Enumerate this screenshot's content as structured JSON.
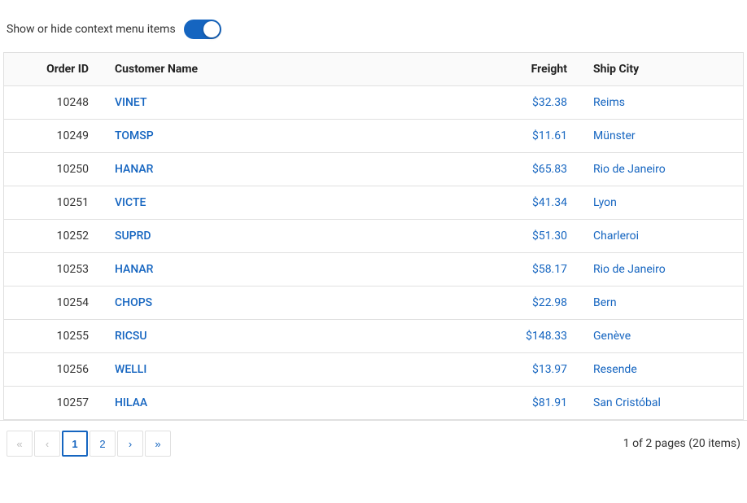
{
  "toggle": {
    "label": "Show or hide context menu items",
    "checked": true
  },
  "table": {
    "columns": [
      {
        "key": "orderid",
        "label": "Order ID"
      },
      {
        "key": "customer",
        "label": "Customer Name"
      },
      {
        "key": "freight",
        "label": "Freight"
      },
      {
        "key": "shipcity",
        "label": "Ship City"
      }
    ],
    "rows": [
      {
        "orderid": "10248",
        "customer": "VINET",
        "freight": "$32.38",
        "shipcity": "Reims"
      },
      {
        "orderid": "10249",
        "customer": "TOMSP",
        "freight": "$11.61",
        "shipcity": "Münster"
      },
      {
        "orderid": "10250",
        "customer": "HANAR",
        "freight": "$65.83",
        "shipcity": "Rio de Janeiro"
      },
      {
        "orderid": "10251",
        "customer": "VICTE",
        "freight": "$41.34",
        "shipcity": "Lyon"
      },
      {
        "orderid": "10252",
        "customer": "SUPRD",
        "freight": "$51.30",
        "shipcity": "Charleroi"
      },
      {
        "orderid": "10253",
        "customer": "HANAR",
        "freight": "$58.17",
        "shipcity": "Rio de Janeiro"
      },
      {
        "orderid": "10254",
        "customer": "CHOPS",
        "freight": "$22.98",
        "shipcity": "Bern"
      },
      {
        "orderid": "10255",
        "customer": "RICSU",
        "freight": "$148.33",
        "shipcity": "Genève"
      },
      {
        "orderid": "10256",
        "customer": "WELLI",
        "freight": "$13.97",
        "shipcity": "Resende"
      },
      {
        "orderid": "10257",
        "customer": "HILAA",
        "freight": "$81.91",
        "shipcity": "San Cristóbal"
      }
    ]
  },
  "pagination": {
    "first_label": "«",
    "prev_label": "‹",
    "next_label": "›",
    "last_label": "»",
    "pages": [
      "1",
      "2"
    ],
    "current_page": "1",
    "info_text": "1 of 2 pages (20 items)"
  }
}
